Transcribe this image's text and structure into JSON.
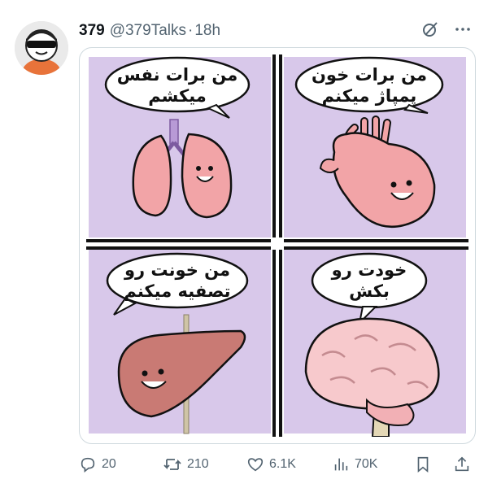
{
  "post": {
    "author_name": "379",
    "handle": "@379Talks",
    "separator": "·",
    "time": "18h"
  },
  "icons": {
    "grok": "grok-icon",
    "more": "more-icon",
    "reply": "reply-icon",
    "repost": "repost-icon",
    "like": "like-icon",
    "views": "views-icon",
    "bookmark": "bookmark-icon",
    "share": "share-icon"
  },
  "comic": {
    "panels": [
      {
        "speech_line1": "من برات نفس",
        "speech_line2": "میکشم",
        "character": "lungs"
      },
      {
        "speech_line1": "من برات خون",
        "speech_line2": "پمپاژ میکنم",
        "character": "heart"
      },
      {
        "speech_line1": "من خونت رو",
        "speech_line2": "تصفیه میکنم",
        "character": "liver"
      },
      {
        "speech_line1": "خودت رو",
        "speech_line2": "بکش",
        "character": "brain"
      }
    ],
    "colors": {
      "background": "#d8c8ea",
      "border": "#111111",
      "organ": "#f2a4a7",
      "liver": "#c97a74"
    }
  },
  "actions": {
    "replies": "20",
    "reposts": "210",
    "likes": "6.1K",
    "views": "70K"
  },
  "colors": {
    "text_primary": "#0f1419",
    "text_secondary": "#536471",
    "border": "#cfd9de"
  }
}
